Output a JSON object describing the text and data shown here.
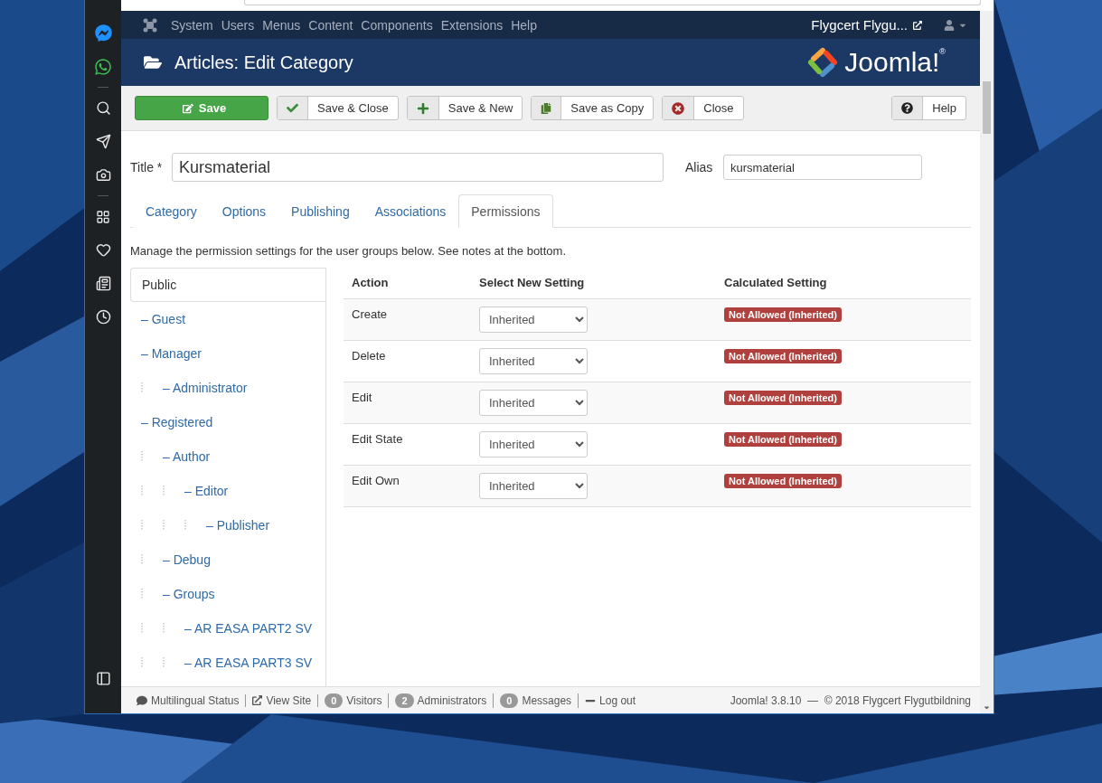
{
  "navbar": {
    "menu": [
      "System",
      "Users",
      "Menus",
      "Content",
      "Components",
      "Extensions",
      "Help"
    ],
    "site_link": "Flygcert Flygu..."
  },
  "header": {
    "title": "Articles: Edit Category",
    "logo_text": "Joomla!$^{®}$"
  },
  "toolbar": {
    "buttons": [
      {
        "label": "Save",
        "kind": "save"
      },
      {
        "label": "Save & Close",
        "kind": "check"
      },
      {
        "label": "Save & New",
        "kind": "plus"
      },
      {
        "label": "Save as Copy",
        "kind": "copy"
      },
      {
        "label": "Close",
        "kind": "close"
      }
    ],
    "help": {
      "label": "Help",
      "kind": "help"
    }
  },
  "form": {
    "title_label": "Title *",
    "title_value": "Kursmaterial",
    "alias_label": "Alias",
    "alias_value": "kursmaterial"
  },
  "tabs": [
    {
      "label": "Category",
      "selected": false
    },
    {
      "label": "Options",
      "selected": false
    },
    {
      "label": "Publishing",
      "selected": false
    },
    {
      "label": "Associations",
      "selected": false
    },
    {
      "label": "Permissions",
      "selected": true
    }
  ],
  "notice": "Manage the permission settings for the user groups below. See notes at the bottom.",
  "groups": [
    {
      "label": "Public",
      "selected": true,
      "children": [
        {
          "label": "– Guest",
          "selected": false
        },
        {
          "label": "– Manager",
          "selected": false,
          "children": [
            {
              "label": "– Administrator",
              "selected": false
            }
          ]
        },
        {
          "label": "– Registered",
          "selected": false,
          "children": [
            {
              "label": "– Author",
              "selected": false,
              "children": [
                {
                  "label": "– Editor",
                  "selected": false,
                  "children": [
                    {
                      "label": "– Publisher",
                      "selected": false
                    }
                  ]
                }
              ]
            },
            {
              "label": "– Debug",
              "selected": false
            },
            {
              "label": "– Groups",
              "selected": false,
              "children": [
                {
                  "label": "– AR EASA PART2 SV",
                  "selected": false
                },
                {
                  "label": "– AR EASA PART3 SV",
                  "selected": false
                }
              ]
            }
          ]
        }
      ]
    }
  ],
  "table": {
    "columns": [
      "Action",
      "Select New Setting",
      "Calculated Setting"
    ],
    "rows": [
      {
        "action": "Create",
        "setting": "Inherited",
        "calculated": "Not Allowed (Inherited)"
      },
      {
        "action": "Delete",
        "setting": "Inherited",
        "calculated": "Not Allowed (Inherited)"
      },
      {
        "action": "Edit",
        "setting": "Inherited",
        "calculated": "Not Allowed (Inherited)"
      },
      {
        "action": "Edit State",
        "setting": "Inherited",
        "calculated": "Not Allowed (Inherited)"
      },
      {
        "action": "Edit Own",
        "setting": "Inherited",
        "calculated": "Not Allowed (Inherited)"
      }
    ]
  },
  "footer": {
    "items": [
      {
        "kind": "multilingual",
        "label": "Multilingual Status"
      },
      {
        "kind": "link",
        "label": "View Site"
      },
      {
        "kind": "count",
        "count": "0",
        "label": "Visitors"
      },
      {
        "kind": "count",
        "count": "2",
        "label": "Administrators"
      },
      {
        "kind": "count",
        "count": "0",
        "label": "Messages"
      },
      {
        "kind": "logout",
        "label": "Log out"
      }
    ],
    "version": "Joomla! 3.8.10  —  © 2018 Flygcert Flygutbildning"
  }
}
